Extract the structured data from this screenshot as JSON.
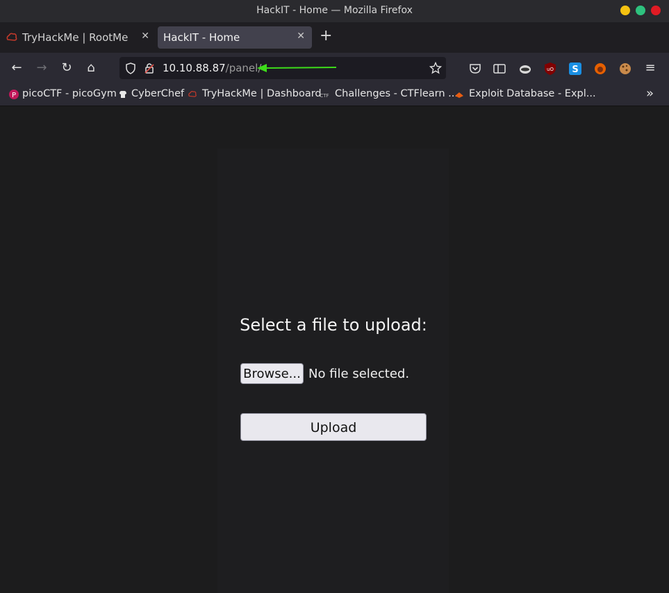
{
  "window": {
    "title": "HackIT - Home — Mozilla Firefox"
  },
  "tabs": [
    {
      "label": "TryHackMe | RootMe",
      "active": false
    },
    {
      "label": "HackIT - Home",
      "active": true
    }
  ],
  "urlbar": {
    "host": "10.10.88.87",
    "path": "/panel/"
  },
  "annotation": {
    "arrow_color": "#3ddc1a"
  },
  "bookmarks": [
    {
      "label": "picoCTF - picoGym",
      "icon": "picoctf-icon"
    },
    {
      "label": "CyberChef",
      "icon": "cyberchef-icon"
    },
    {
      "label": "TryHackMe | Dashboard",
      "icon": "tryhackme-icon"
    },
    {
      "label": "Challenges - CTFlearn ...",
      "icon": "ctflearn-icon"
    },
    {
      "label": "Exploit Database - Expl...",
      "icon": "exploitdb-icon"
    }
  ],
  "page": {
    "heading": "Select a file to upload:",
    "browse_label": "Browse...",
    "file_status": "No file selected.",
    "upload_label": "Upload"
  },
  "colors": {
    "titlebar": "#2a2a2e",
    "toolbar": "#2b2a33",
    "page_bg": "#1c1c1d",
    "button_bg": "#e9e8ee"
  }
}
